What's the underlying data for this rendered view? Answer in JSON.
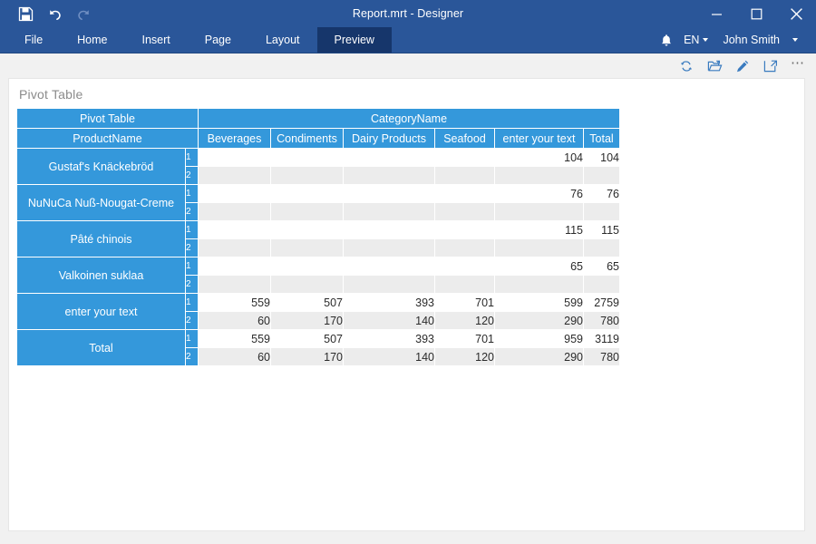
{
  "window": {
    "title": "Report.mrt - Designer",
    "quick_access": [
      {
        "name": "save-icon",
        "label": "Save",
        "disabled": false
      },
      {
        "name": "undo-icon",
        "label": "Undo",
        "disabled": false
      },
      {
        "name": "redo-icon",
        "label": "Redo",
        "disabled": true
      }
    ],
    "controls": [
      {
        "name": "minimize-button",
        "label": "Minimize"
      },
      {
        "name": "maximize-button",
        "label": "Maximize"
      },
      {
        "name": "close-button",
        "label": "Close"
      }
    ]
  },
  "ribbon": {
    "tabs": [
      {
        "label": "File",
        "active": false
      },
      {
        "label": "Home",
        "active": false
      },
      {
        "label": "Insert",
        "active": false
      },
      {
        "label": "Page",
        "active": false
      },
      {
        "label": "Layout",
        "active": false
      },
      {
        "label": "Preview",
        "active": true
      }
    ],
    "notifications_icon": "bell-icon",
    "language": "EN",
    "user": "John Smith"
  },
  "preview_toolbar": {
    "buttons": [
      {
        "name": "refresh-button",
        "label": "Refresh"
      },
      {
        "name": "open-button",
        "label": "Open"
      },
      {
        "name": "edit-button",
        "label": "Edit"
      },
      {
        "name": "fullscreen-button",
        "label": "Full Screen"
      },
      {
        "name": "more-button",
        "label": "More"
      }
    ],
    "more_glyph": "⋯"
  },
  "page": {
    "title": "Pivot Table"
  },
  "colors": {
    "titlebar": "#2a5699",
    "active_tab": "#16366b",
    "table_header": "#3498db",
    "row_alt": "#ececec",
    "page_bg": "#ffffff",
    "workspace_bg": "#f1f1f1"
  },
  "pivot_table": {
    "corner_label": "Pivot Table",
    "column_group_label": "CategoryName",
    "row_field_label": "ProductName",
    "columns": [
      "Beverages",
      "Condiments",
      "Dairy Products",
      "Seafood",
      "enter your text",
      "Total"
    ],
    "sub_rows": [
      "1",
      "2"
    ],
    "rows": [
      {
        "label": "Gustaf's Knäckebröd",
        "values": [
          [
            "",
            "",
            "",
            "",
            "104",
            "104"
          ],
          [
            "",
            "",
            "",
            "",
            "",
            ""
          ]
        ]
      },
      {
        "label": "NuNuCa Nuß-Nougat-Creme",
        "values": [
          [
            "",
            "",
            "",
            "",
            "76",
            "76"
          ],
          [
            "",
            "",
            "",
            "",
            "",
            ""
          ]
        ]
      },
      {
        "label": "Pâté chinois",
        "values": [
          [
            "",
            "",
            "",
            "",
            "115",
            "115"
          ],
          [
            "",
            "",
            "",
            "",
            "",
            ""
          ]
        ]
      },
      {
        "label": "Valkoinen suklaa",
        "values": [
          [
            "",
            "",
            "",
            "",
            "65",
            "65"
          ],
          [
            "",
            "",
            "",
            "",
            "",
            ""
          ]
        ]
      },
      {
        "label": "enter your text",
        "values": [
          [
            "559",
            "507",
            "393",
            "701",
            "599",
            "2759"
          ],
          [
            "60",
            "170",
            "140",
            "120",
            "290",
            "780"
          ]
        ]
      },
      {
        "label": "Total",
        "values": [
          [
            "559",
            "507",
            "393",
            "701",
            "959",
            "3119"
          ],
          [
            "60",
            "170",
            "140",
            "120",
            "290",
            "780"
          ]
        ]
      }
    ]
  }
}
